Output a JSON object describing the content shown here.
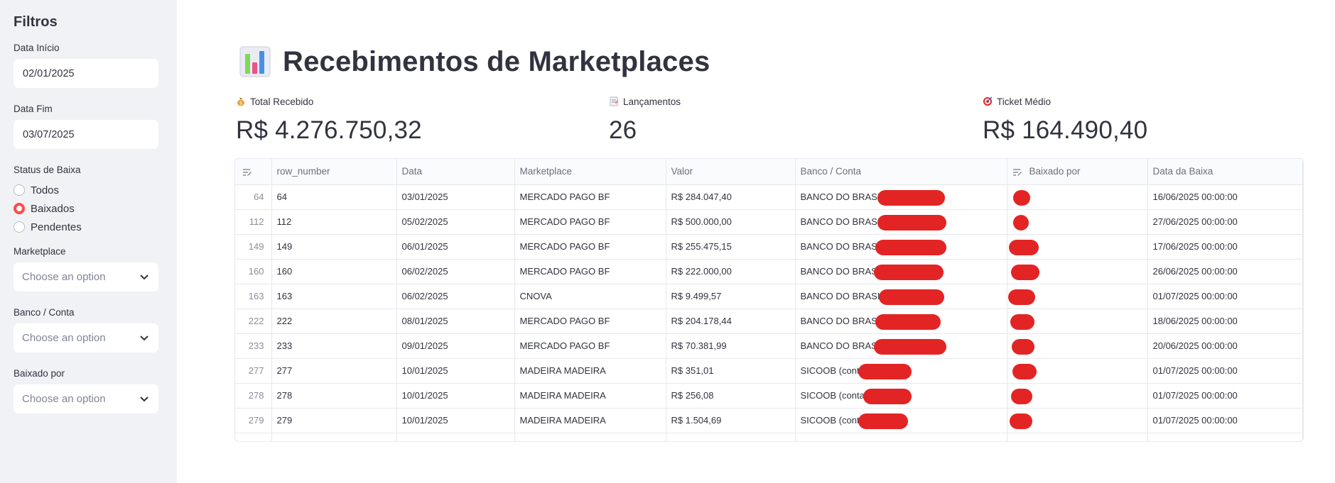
{
  "sidebar": {
    "title": "Filtros",
    "start_date": {
      "label": "Data Início",
      "value": "02/01/2025"
    },
    "end_date": {
      "label": "Data Fim",
      "value": "03/07/2025"
    },
    "status": {
      "label": "Status de Baixa",
      "options": [
        {
          "label": "Todos",
          "checked": false
        },
        {
          "label": "Baixados",
          "checked": true
        },
        {
          "label": "Pendentes",
          "checked": false
        }
      ]
    },
    "marketplace": {
      "label": "Marketplace",
      "placeholder": "Choose an option"
    },
    "banco": {
      "label": "Banco / Conta",
      "placeholder": "Choose an option"
    },
    "baixado_por": {
      "label": "Baixado por",
      "placeholder": "Choose an option"
    }
  },
  "header": {
    "title": "Recebimentos de Marketplaces",
    "icon": "bar-chart-icon"
  },
  "metrics": [
    {
      "icon": "money-bag-icon",
      "label": "Total Recebido",
      "value": "R$ 4.276.750,32"
    },
    {
      "icon": "memo-icon",
      "label": "Lançamentos",
      "value": "26"
    },
    {
      "icon": "target-icon",
      "label": "Ticket Médio",
      "value": "R$ 164.490,40"
    }
  ],
  "table": {
    "columns": [
      "row_number",
      "Data",
      "Marketplace",
      "Valor",
      "Banco / Conta",
      "Baixado por",
      "Data da Baixa"
    ],
    "rows": [
      {
        "idx": "64",
        "row_number": "64",
        "data": "03/01/2025",
        "marketplace": "MERCADO PAGO BF",
        "valor": "R$ 284.047,40",
        "banco": "BANCO DO BRASIL",
        "baixado_por": "",
        "data_baixa": "16/06/2025 00:00:00"
      },
      {
        "idx": "112",
        "row_number": "112",
        "data": "05/02/2025",
        "marketplace": "MERCADO PAGO BF",
        "valor": "R$ 500.000,00",
        "banco": "BANCO DO BRASIL",
        "baixado_por": "",
        "data_baixa": "27/06/2025 00:00:00"
      },
      {
        "idx": "149",
        "row_number": "149",
        "data": "06/01/2025",
        "marketplace": "MERCADO PAGO BF",
        "valor": "R$ 255.475,15",
        "banco": "BANCO DO BRASIL",
        "baixado_por": "",
        "data_baixa": "17/06/2025 00:00:00"
      },
      {
        "idx": "160",
        "row_number": "160",
        "data": "06/02/2025",
        "marketplace": "MERCADO PAGO BF",
        "valor": "R$ 222.000,00",
        "banco": "BANCO DO BRASIL",
        "baixado_por": "",
        "data_baixa": "26/06/2025 00:00:00"
      },
      {
        "idx": "163",
        "row_number": "163",
        "data": "06/02/2025",
        "marketplace": "CNOVA",
        "valor": "R$ 9.499,57",
        "banco": "BANCO DO BRASIL",
        "baixado_por": "",
        "data_baixa": "01/07/2025 00:00:00"
      },
      {
        "idx": "222",
        "row_number": "222",
        "data": "08/01/2025",
        "marketplace": "MERCADO PAGO BF",
        "valor": "R$ 204.178,44",
        "banco": "BANCO DO BRASIL",
        "baixado_por": "",
        "data_baixa": "18/06/2025 00:00:00"
      },
      {
        "idx": "233",
        "row_number": "233",
        "data": "09/01/2025",
        "marketplace": "MERCADO PAGO BF",
        "valor": "R$ 70.381,99",
        "banco": "BANCO DO BRASIL",
        "baixado_por": "",
        "data_baixa": "20/06/2025 00:00:00"
      },
      {
        "idx": "277",
        "row_number": "277",
        "data": "10/01/2025",
        "marketplace": "MADEIRA MADEIRA",
        "valor": "R$ 351,01",
        "banco": "SICOOB (conta",
        "baixado_por": "",
        "data_baixa": "01/07/2025 00:00:00"
      },
      {
        "idx": "278",
        "row_number": "278",
        "data": "10/01/2025",
        "marketplace": "MADEIRA MADEIRA",
        "valor": "R$ 256,08",
        "banco": "SICOOB (conta",
        "baixado_por": "",
        "data_baixa": "01/07/2025 00:00:00"
      },
      {
        "idx": "279",
        "row_number": "279",
        "data": "10/01/2025",
        "marketplace": "MADEIRA MADEIRA",
        "valor": "R$ 1.504,69",
        "banco": "SICOOB (conta",
        "baixado_por": "",
        "data_baixa": "01/07/2025 00:00:00"
      }
    ]
  },
  "colors": {
    "accent": "#ff4b4b",
    "sidebar_bg": "#f0f2f6",
    "redaction": "#e32424"
  }
}
